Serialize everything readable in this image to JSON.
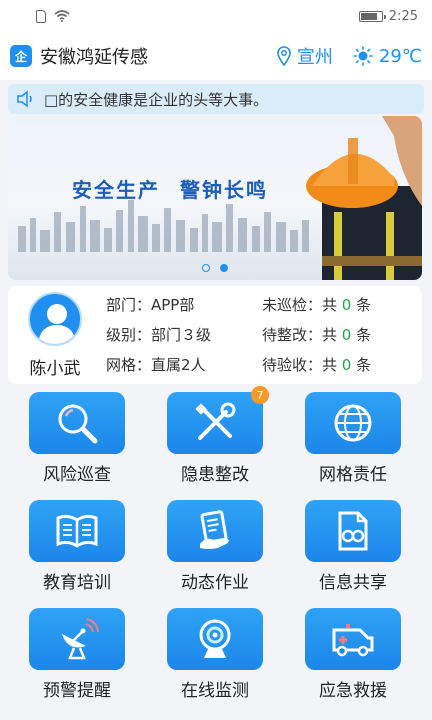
{
  "status_bar": {
    "time": "2:25"
  },
  "header": {
    "app_title": "安徽鸿延传感",
    "logo_text": "企",
    "location": "宣州",
    "temperature": "29℃",
    "accent_color": "#1f8ff0"
  },
  "notice": {
    "text": "□的安全健康是企业的头等大事。"
  },
  "banner": {
    "slogan_1": "安全生产",
    "slogan_2": "警钟长鸣",
    "active_slide": 2,
    "slide_count": 2
  },
  "user": {
    "name": "陈小武",
    "department": "部门：APP部",
    "level": "级别：部门３级",
    "grid": "网格：直属2人",
    "stats": [
      {
        "label": "未巡检：共",
        "count": "0",
        "unit": "条"
      },
      {
        "label": "待整改：共",
        "count": "0",
        "unit": "条"
      },
      {
        "label": "待验收：共",
        "count": "0",
        "unit": "条"
      }
    ],
    "count_color": "#23a24d"
  },
  "modules": [
    {
      "label": "风险巡查",
      "icon": "magnifier-icon"
    },
    {
      "label": "隐患整改",
      "icon": "tools-icon",
      "badge": "7"
    },
    {
      "label": "网格责任",
      "icon": "globe-icon"
    },
    {
      "label": "教育培训",
      "icon": "book-icon"
    },
    {
      "label": "动态作业",
      "icon": "document-hand-icon"
    },
    {
      "label": "信息共享",
      "icon": "share-document-icon"
    },
    {
      "label": "预警提醒",
      "icon": "satellite-dish-icon"
    },
    {
      "label": "在线监测",
      "icon": "camera-icon"
    },
    {
      "label": "应急救援",
      "icon": "ambulance-icon"
    }
  ]
}
